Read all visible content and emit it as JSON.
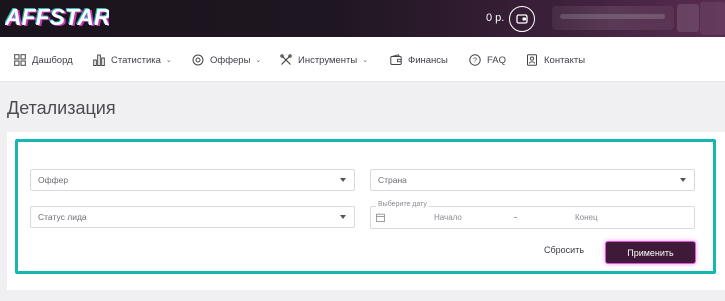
{
  "brand": {
    "logo_text": "AFFSTAR"
  },
  "header": {
    "balance": "0 р.",
    "wallet_icon": "wallet-icon"
  },
  "nav": {
    "items": [
      {
        "label": "Дашборд",
        "icon": "dashboard-icon",
        "has_dropdown": false
      },
      {
        "label": "Статистика",
        "icon": "bar-chart-icon",
        "has_dropdown": true
      },
      {
        "label": "Офферы",
        "icon": "offers-icon",
        "has_dropdown": true
      },
      {
        "label": "Инструменты",
        "icon": "tools-icon",
        "has_dropdown": true
      },
      {
        "label": "Финансы",
        "icon": "wallet-icon",
        "has_dropdown": false
      },
      {
        "label": "FAQ",
        "icon": "help-icon",
        "has_dropdown": false
      },
      {
        "label": "Контакты",
        "icon": "contacts-icon",
        "has_dropdown": false
      }
    ]
  },
  "page": {
    "title": "Детализация"
  },
  "filters": {
    "offer": {
      "placeholder": "Оффер"
    },
    "country": {
      "placeholder": "Страна"
    },
    "lead_status": {
      "placeholder": "Статус лида"
    },
    "date_range": {
      "legend": "Выберите дату",
      "start_placeholder": "Начало",
      "separator": "-",
      "end_placeholder": "Конец"
    },
    "reset_label": "Сбросить",
    "apply_label": "Применить"
  },
  "colors": {
    "accent_teal": "#14b8b0",
    "apply_bg": "#3e1a38",
    "apply_border": "#e056d8",
    "header_dark": "#1a141d"
  }
}
